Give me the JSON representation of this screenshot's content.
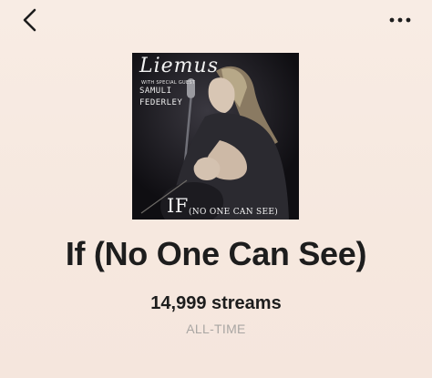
{
  "header": {
    "back_icon": "chevron-left-icon",
    "more_icon": "more-horizontal-icon"
  },
  "cover": {
    "artist": "Liemus",
    "special_guest_caption": "WITH SPECIAL GUEST",
    "guest_line_1": "SAMULI",
    "guest_line_2": "FEDERLEY",
    "title_main": "IF",
    "title_sub": "(NO ONE CAN SEE)"
  },
  "song": {
    "title": "If (No One Can See)",
    "streams": "14,999 streams",
    "period": "ALL-TIME"
  },
  "colors": {
    "background": "#f7ebe3",
    "title_text": "#1d1d1d",
    "muted_text": "#a9a6a3"
  }
}
